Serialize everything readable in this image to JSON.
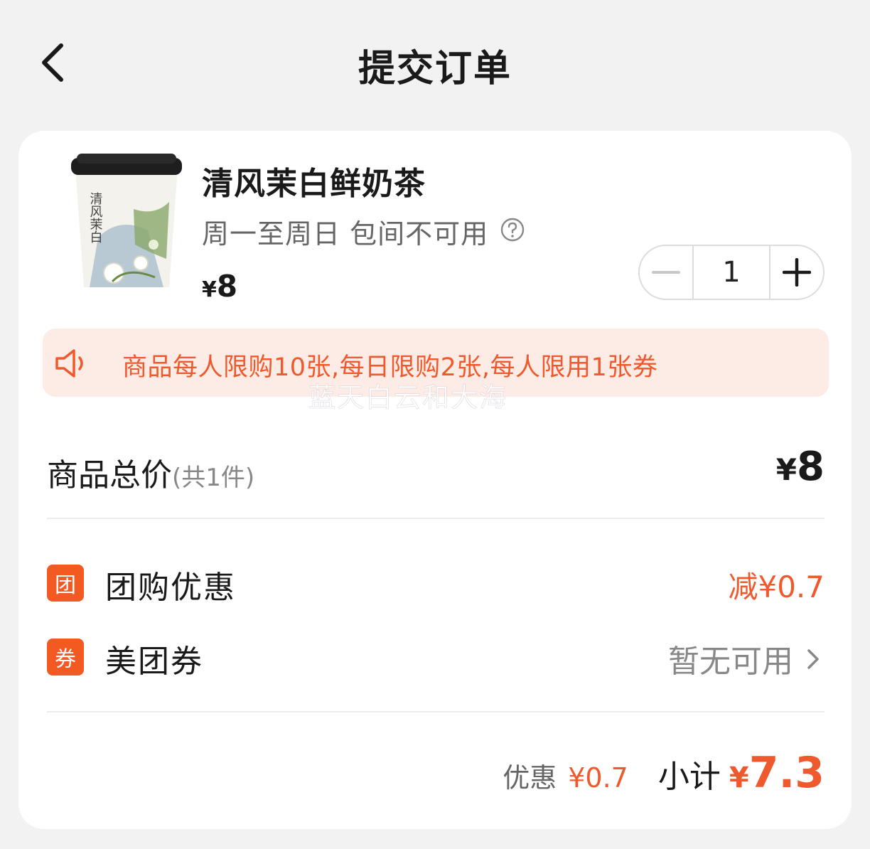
{
  "header": {
    "title": "提交订单"
  },
  "product": {
    "name": "清风茉白鲜奶茶",
    "availability": "周一至周日 包间不可用",
    "currency": "¥",
    "price": "8",
    "cup_text": "清风茉白",
    "quantity": "1"
  },
  "notice": {
    "text": "商品每人限购10张,每日限购2张,每人限用1张券",
    "watermark": "蓝天白云和大海"
  },
  "total": {
    "label": "商品总价",
    "count": "(共1件)",
    "currency": "¥",
    "price": "8"
  },
  "group_discount": {
    "badge": "团",
    "label": "团购优惠",
    "value": "减¥0.7"
  },
  "coupon": {
    "badge": "券",
    "label": "美团券",
    "value": "暂无可用"
  },
  "subtotal": {
    "discount_label": "优惠",
    "discount_value": "¥0.7",
    "label": "小计",
    "currency": "¥",
    "value": "7.3"
  },
  "colors": {
    "accent": "#ee5a2e",
    "badge": "#f25a22",
    "notice_bg": "#fdebe5",
    "page_bg": "#f2f2f2"
  }
}
